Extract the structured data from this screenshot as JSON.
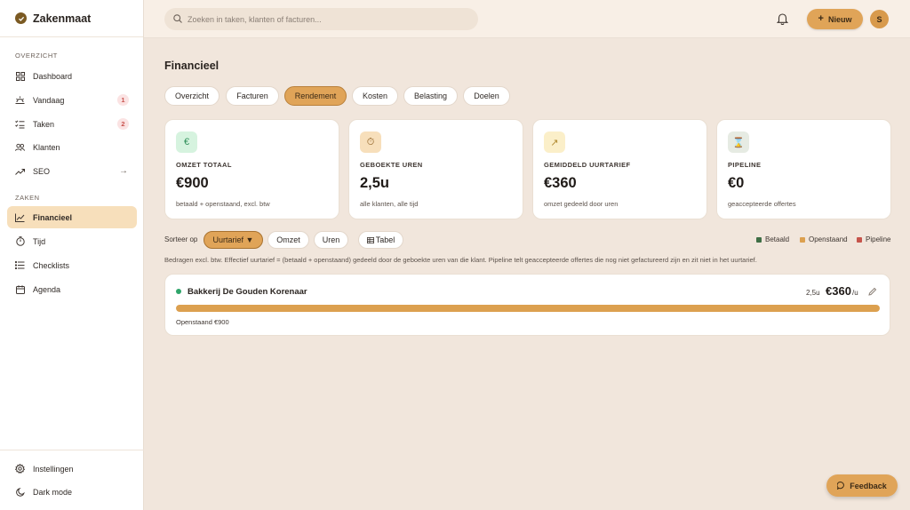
{
  "app": {
    "name": "Zakenmaat"
  },
  "search": {
    "placeholder": "Zoeken in taken, klanten of facturen..."
  },
  "topbar": {
    "new_label": "Nieuw",
    "avatar_initial": "S"
  },
  "sidebar": {
    "overview_heading": "OVERZICHT",
    "overview_items": [
      {
        "label": "Dashboard",
        "icon": "grid-icon"
      },
      {
        "label": "Vandaag",
        "icon": "sunrise-icon",
        "badge": "1"
      },
      {
        "label": "Taken",
        "icon": "checklist-icon",
        "badge": "2"
      },
      {
        "label": "Klanten",
        "icon": "users-icon"
      },
      {
        "label": "SEO",
        "icon": "trend-icon",
        "arrow": "→"
      }
    ],
    "business_heading": "ZAKEN",
    "business_items": [
      {
        "label": "Financieel",
        "icon": "chart-line-icon",
        "active": true
      },
      {
        "label": "Tijd",
        "icon": "stopwatch-icon"
      },
      {
        "label": "Checklists",
        "icon": "list-icon"
      },
      {
        "label": "Agenda",
        "icon": "calendar-icon"
      }
    ],
    "bottom_items": [
      {
        "label": "Instellingen",
        "icon": "gear-icon"
      },
      {
        "label": "Dark mode",
        "icon": "moon-icon"
      }
    ]
  },
  "main": {
    "title": "Financieel",
    "tabs": [
      {
        "label": "Overzicht"
      },
      {
        "label": "Facturen"
      },
      {
        "label": "Rendement",
        "active": true
      },
      {
        "label": "Kosten"
      },
      {
        "label": "Belasting"
      },
      {
        "label": "Doelen"
      }
    ],
    "cards": [
      {
        "label": "OMZET TOTAAL",
        "value": "€900",
        "sub": "betaald + openstaand, excl. btw",
        "icon": "euro-icon",
        "icon_glyph": "€",
        "icon_bg": "#d6f3df",
        "icon_color": "#2f8f5a"
      },
      {
        "label": "GEBOEKTE UREN",
        "value": "2,5u",
        "sub": "alle klanten, alle tijd",
        "icon": "stopwatch-icon",
        "icon_glyph": "⏱",
        "icon_bg": "#f7dfbb",
        "icon_color": "#8a5a1c"
      },
      {
        "label": "GEMIDDELD UURTARIEF",
        "value": "€360",
        "sub": "omzet gedeeld door uren",
        "icon": "trend-up-icon",
        "icon_glyph": "↗",
        "icon_bg": "#fbefc9",
        "icon_color": "#b08a2e"
      },
      {
        "label": "PIPELINE",
        "value": "€0",
        "sub": "geaccepteerde offertes",
        "icon": "hourglass-icon",
        "icon_glyph": "⌛",
        "icon_bg": "#e6ebe3",
        "icon_color": "#4f5a4a"
      }
    ],
    "sort": {
      "label": "Sorteer op",
      "options": [
        {
          "label": "Uurtarief ▼",
          "active": true
        },
        {
          "label": "Omzet"
        },
        {
          "label": "Uren"
        }
      ],
      "table_label": "Tabel",
      "table_icon": "table-icon"
    },
    "legend": [
      {
        "label": "Betaald",
        "color": "#3f6e45"
      },
      {
        "label": "Openstaand",
        "color": "#dca04f"
      },
      {
        "label": "Pipeline",
        "color": "#c6544b"
      }
    ],
    "note": "Bedragen excl. btw. Effectief uurtarief = (betaald + openstaand) gedeeld door de geboekte uren van die klant. Pipeline telt geaccepteerde offertes die nog niet gefactureerd zijn en zit niet in het uurtarief.",
    "clients": [
      {
        "name": "Bakkerij De Gouden Korenaar",
        "hours": "2,5u",
        "rate": "€360",
        "rate_unit": "/u",
        "outstanding_label": "Openstaand €900",
        "outstanding_fraction": 1.0
      }
    ]
  },
  "feedback": {
    "label": "Feedback"
  }
}
